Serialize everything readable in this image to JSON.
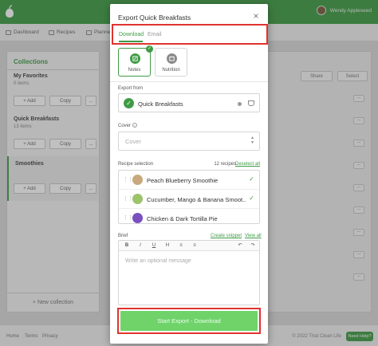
{
  "user": {
    "name": "Wendy Appleseed"
  },
  "nav": {
    "items": [
      "Dashboard",
      "Recipes",
      "Planner"
    ]
  },
  "collections": {
    "title": "Collections",
    "items": [
      {
        "name": "My Favorites",
        "count": "0 items"
      },
      {
        "name": "Quick Breakfasts",
        "count": "13 items"
      },
      {
        "name": "Smoothies",
        "count": ""
      }
    ],
    "add_label": "+ Add",
    "copy_label": "Copy",
    "more_label": "...",
    "new_label": "+  New collection"
  },
  "main": {
    "share_label": "Share",
    "select_label": "Select"
  },
  "footer": {
    "home": "Home",
    "terms": "Terms",
    "privacy": "Privacy",
    "copyright": "© 2022 That Clean Life",
    "help": "Need Help?"
  },
  "modal": {
    "title": "Export Quick Breakfasts",
    "close": "×",
    "tabs": [
      {
        "label": "Download",
        "active": true
      },
      {
        "label": "Email",
        "active": false
      }
    ],
    "formats": [
      {
        "label": "Notes",
        "selected": true
      },
      {
        "label": "Nutrition",
        "selected": false
      }
    ],
    "export_from_label": "Export from",
    "source": "Quick Breakfasts",
    "cover_label": "Cover",
    "cover_placeholder": "Cover",
    "recipe_selection_label": "Recipe selection",
    "recipes_count": "12 recipes",
    "deselect_all": "Deselect all",
    "recipes": [
      {
        "name": "Peach Blueberry Smoothie",
        "checked": true,
        "color": "#c9a87d"
      },
      {
        "name": "Cucumber, Mango & Banana Smoot...",
        "checked": true,
        "color": "#9dc36b"
      },
      {
        "name": "Chicken & Dark Tortilla Pie",
        "checked": false,
        "color": "#7a4fbf"
      }
    ],
    "brief_label": "Brief",
    "create_snippet": "Create snippet",
    "view_all": "View all",
    "toolbar": [
      "B",
      "I",
      "U",
      "H",
      "≡",
      "≡",
      "↶",
      "↷"
    ],
    "brief_placeholder": "Write an optional message",
    "export_button": "Start Export - Download"
  },
  "colors": {
    "brand": "#3e9b45",
    "export_button": "#6fd36a",
    "highlight": "#e0332f"
  }
}
